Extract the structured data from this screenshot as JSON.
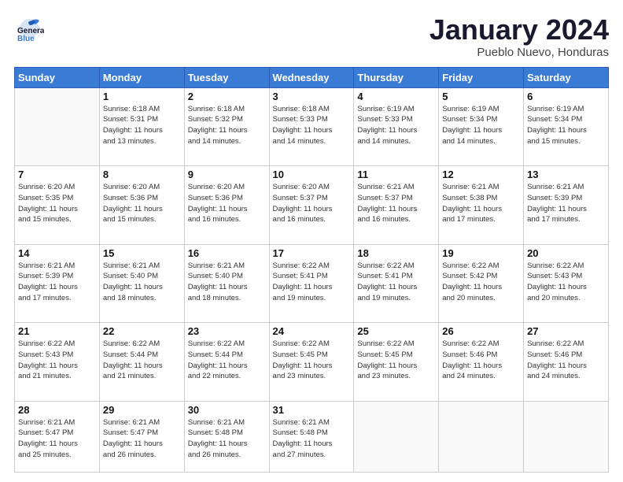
{
  "header": {
    "logo_general": "General",
    "logo_blue": "Blue",
    "month_title": "January 2024",
    "subtitle": "Pueblo Nuevo, Honduras"
  },
  "days_of_week": [
    "Sunday",
    "Monday",
    "Tuesday",
    "Wednesday",
    "Thursday",
    "Friday",
    "Saturday"
  ],
  "weeks": [
    [
      {
        "day": "",
        "info": ""
      },
      {
        "day": "1",
        "info": "Sunrise: 6:18 AM\nSunset: 5:31 PM\nDaylight: 11 hours\nand 13 minutes."
      },
      {
        "day": "2",
        "info": "Sunrise: 6:18 AM\nSunset: 5:32 PM\nDaylight: 11 hours\nand 14 minutes."
      },
      {
        "day": "3",
        "info": "Sunrise: 6:18 AM\nSunset: 5:33 PM\nDaylight: 11 hours\nand 14 minutes."
      },
      {
        "day": "4",
        "info": "Sunrise: 6:19 AM\nSunset: 5:33 PM\nDaylight: 11 hours\nand 14 minutes."
      },
      {
        "day": "5",
        "info": "Sunrise: 6:19 AM\nSunset: 5:34 PM\nDaylight: 11 hours\nand 14 minutes."
      },
      {
        "day": "6",
        "info": "Sunrise: 6:19 AM\nSunset: 5:34 PM\nDaylight: 11 hours\nand 15 minutes."
      }
    ],
    [
      {
        "day": "7",
        "info": "Sunrise: 6:20 AM\nSunset: 5:35 PM\nDaylight: 11 hours\nand 15 minutes."
      },
      {
        "day": "8",
        "info": "Sunrise: 6:20 AM\nSunset: 5:36 PM\nDaylight: 11 hours\nand 15 minutes."
      },
      {
        "day": "9",
        "info": "Sunrise: 6:20 AM\nSunset: 5:36 PM\nDaylight: 11 hours\nand 16 minutes."
      },
      {
        "day": "10",
        "info": "Sunrise: 6:20 AM\nSunset: 5:37 PM\nDaylight: 11 hours\nand 16 minutes."
      },
      {
        "day": "11",
        "info": "Sunrise: 6:21 AM\nSunset: 5:37 PM\nDaylight: 11 hours\nand 16 minutes."
      },
      {
        "day": "12",
        "info": "Sunrise: 6:21 AM\nSunset: 5:38 PM\nDaylight: 11 hours\nand 17 minutes."
      },
      {
        "day": "13",
        "info": "Sunrise: 6:21 AM\nSunset: 5:39 PM\nDaylight: 11 hours\nand 17 minutes."
      }
    ],
    [
      {
        "day": "14",
        "info": "Sunrise: 6:21 AM\nSunset: 5:39 PM\nDaylight: 11 hours\nand 17 minutes."
      },
      {
        "day": "15",
        "info": "Sunrise: 6:21 AM\nSunset: 5:40 PM\nDaylight: 11 hours\nand 18 minutes."
      },
      {
        "day": "16",
        "info": "Sunrise: 6:21 AM\nSunset: 5:40 PM\nDaylight: 11 hours\nand 18 minutes."
      },
      {
        "day": "17",
        "info": "Sunrise: 6:22 AM\nSunset: 5:41 PM\nDaylight: 11 hours\nand 19 minutes."
      },
      {
        "day": "18",
        "info": "Sunrise: 6:22 AM\nSunset: 5:41 PM\nDaylight: 11 hours\nand 19 minutes."
      },
      {
        "day": "19",
        "info": "Sunrise: 6:22 AM\nSunset: 5:42 PM\nDaylight: 11 hours\nand 20 minutes."
      },
      {
        "day": "20",
        "info": "Sunrise: 6:22 AM\nSunset: 5:43 PM\nDaylight: 11 hours\nand 20 minutes."
      }
    ],
    [
      {
        "day": "21",
        "info": "Sunrise: 6:22 AM\nSunset: 5:43 PM\nDaylight: 11 hours\nand 21 minutes."
      },
      {
        "day": "22",
        "info": "Sunrise: 6:22 AM\nSunset: 5:44 PM\nDaylight: 11 hours\nand 21 minutes."
      },
      {
        "day": "23",
        "info": "Sunrise: 6:22 AM\nSunset: 5:44 PM\nDaylight: 11 hours\nand 22 minutes."
      },
      {
        "day": "24",
        "info": "Sunrise: 6:22 AM\nSunset: 5:45 PM\nDaylight: 11 hours\nand 23 minutes."
      },
      {
        "day": "25",
        "info": "Sunrise: 6:22 AM\nSunset: 5:45 PM\nDaylight: 11 hours\nand 23 minutes."
      },
      {
        "day": "26",
        "info": "Sunrise: 6:22 AM\nSunset: 5:46 PM\nDaylight: 11 hours\nand 24 minutes."
      },
      {
        "day": "27",
        "info": "Sunrise: 6:22 AM\nSunset: 5:46 PM\nDaylight: 11 hours\nand 24 minutes."
      }
    ],
    [
      {
        "day": "28",
        "info": "Sunrise: 6:21 AM\nSunset: 5:47 PM\nDaylight: 11 hours\nand 25 minutes."
      },
      {
        "day": "29",
        "info": "Sunrise: 6:21 AM\nSunset: 5:47 PM\nDaylight: 11 hours\nand 26 minutes."
      },
      {
        "day": "30",
        "info": "Sunrise: 6:21 AM\nSunset: 5:48 PM\nDaylight: 11 hours\nand 26 minutes."
      },
      {
        "day": "31",
        "info": "Sunrise: 6:21 AM\nSunset: 5:48 PM\nDaylight: 11 hours\nand 27 minutes."
      },
      {
        "day": "",
        "info": ""
      },
      {
        "day": "",
        "info": ""
      },
      {
        "day": "",
        "info": ""
      }
    ]
  ]
}
